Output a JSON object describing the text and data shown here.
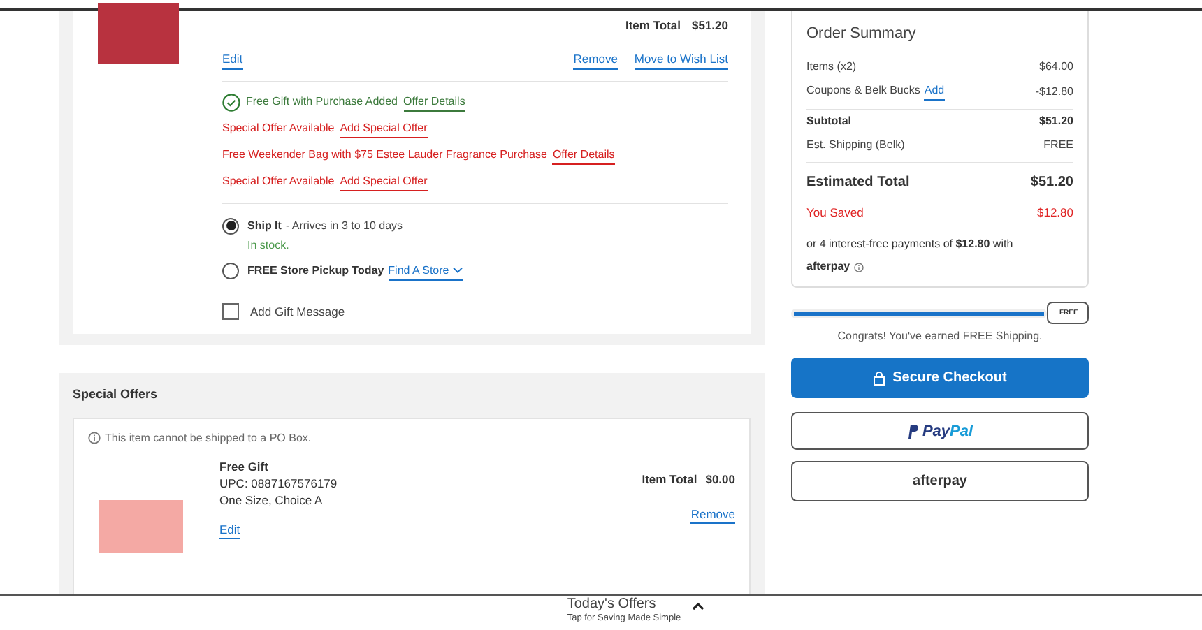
{
  "cart_item": {
    "item_total_label": "Item Total",
    "item_total": "$51.20",
    "edit": "Edit",
    "remove": "Remove",
    "wish_list": "Move to Wish List",
    "offers": [
      {
        "kind": "added",
        "text": "Free Gift with Purchase Added",
        "link": "Offer Details"
      },
      {
        "kind": "available",
        "text": "Special Offer Available",
        "link": "Add Special Offer"
      },
      {
        "kind": "available",
        "text": "Free Weekender Bag with $75 Estee Lauder Fragrance Purchase",
        "link": "Offer Details"
      },
      {
        "kind": "available",
        "text": "Special Offer Available",
        "link": "Add Special Offer"
      }
    ],
    "shipping_options": [
      {
        "label": "Ship It",
        "detail": " - Arrives in 3 to 10 days",
        "note": "In stock.",
        "selected": true
      },
      {
        "label": "FREE Store Pickup Today",
        "link": "Find A Store",
        "selected": false
      }
    ],
    "gift_message": {
      "label": "Add Gift Message",
      "checked": false
    }
  },
  "special_offers": {
    "title": "Special Offers",
    "notice": "This item cannot be shipped to a PO Box.",
    "name": "Free Gift",
    "upc": "UPC: 0887167576179",
    "variant": "One Size, Choice A",
    "item_total_label": "Item Total",
    "item_total": "$0.00",
    "edit": "Edit",
    "remove": "Remove"
  },
  "order_summary": {
    "title": "Order Summary",
    "rows": [
      {
        "kind": "normal",
        "label": "Items (x2)",
        "value": "$64.00"
      },
      {
        "kind": "normal",
        "label": "Coupons & Belk Bucks",
        "link": "Add",
        "value": "-$12.80"
      },
      {
        "kind": "bold",
        "label": "Subtotal",
        "value": "$51.20",
        "divider": true
      },
      {
        "kind": "normal",
        "label": "Est. Shipping (Belk)",
        "value": "FREE"
      },
      {
        "kind": "total",
        "label": "Estimated Total",
        "value": "$51.20",
        "divider": true
      },
      {
        "kind": "saved",
        "label": "You Saved",
        "value": "$12.80"
      }
    ],
    "installments": "or 4 interest-free payments of **$12.80** with",
    "afterpay": "afterpay"
  },
  "shipping_progress": {
    "level": 1,
    "badge": "FREE",
    "message": "Congrats! You've earned FREE Shipping."
  },
  "buttons": {
    "checkout": "Secure Checkout",
    "paypal_1": "Pay",
    "paypal_2": "Pal",
    "afterpay": "afterpay"
  },
  "offers_bar": {
    "title": "Today's Offers",
    "subtitle": "Tap for Saving Made Simple"
  }
}
